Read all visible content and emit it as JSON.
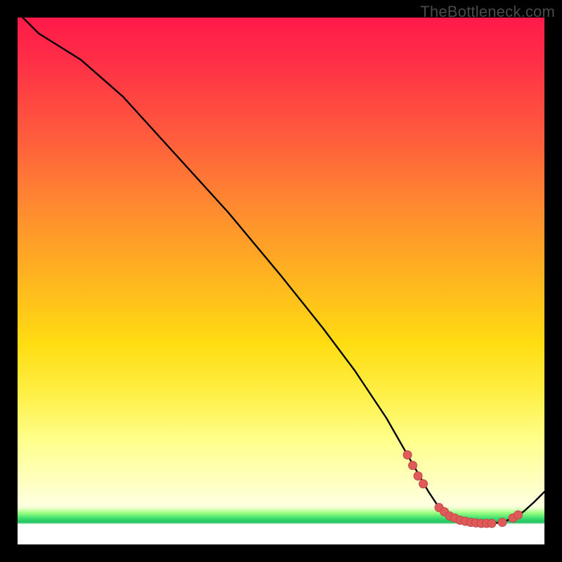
{
  "watermark": "TheBottleneck.com",
  "colors": {
    "background": "#000000",
    "gradient_top": "#ff1a49",
    "gradient_mid": "#ffdd12",
    "gradient_low": "#ffffc0",
    "gradient_green": "#1fc060",
    "line": "#000000",
    "marker_fill": "#e05a5a",
    "marker_stroke": "#c04848"
  },
  "chart_data": {
    "type": "line",
    "title": "",
    "xlabel": "",
    "ylabel": "",
    "xlim": [
      0,
      100
    ],
    "ylim": [
      0,
      100
    ],
    "series": [
      {
        "name": "curve",
        "x": [
          1,
          4,
          8,
          12,
          20,
          30,
          40,
          50,
          58,
          64,
          70,
          74,
          78,
          80,
          82,
          84,
          86,
          88,
          90,
          92,
          94,
          96,
          98,
          100
        ],
        "y": [
          100,
          97,
          94.5,
          92,
          85,
          74,
          63,
          51,
          41,
          33,
          24,
          17,
          10,
          7,
          5,
          4,
          4,
          4,
          4,
          4.2,
          5,
          6.2,
          8,
          10
        ]
      }
    ],
    "markers": {
      "name": "highlight-points",
      "x": [
        74,
        75,
        76,
        77,
        80,
        81,
        82,
        83,
        84,
        85,
        86,
        87,
        88,
        89,
        90,
        92,
        94,
        95
      ],
      "y": [
        17,
        15,
        13,
        11.5,
        7,
        6.2,
        5.4,
        5,
        4.6,
        4.4,
        4.2,
        4.1,
        4,
        4,
        4,
        4.2,
        5,
        5.6
      ]
    }
  }
}
